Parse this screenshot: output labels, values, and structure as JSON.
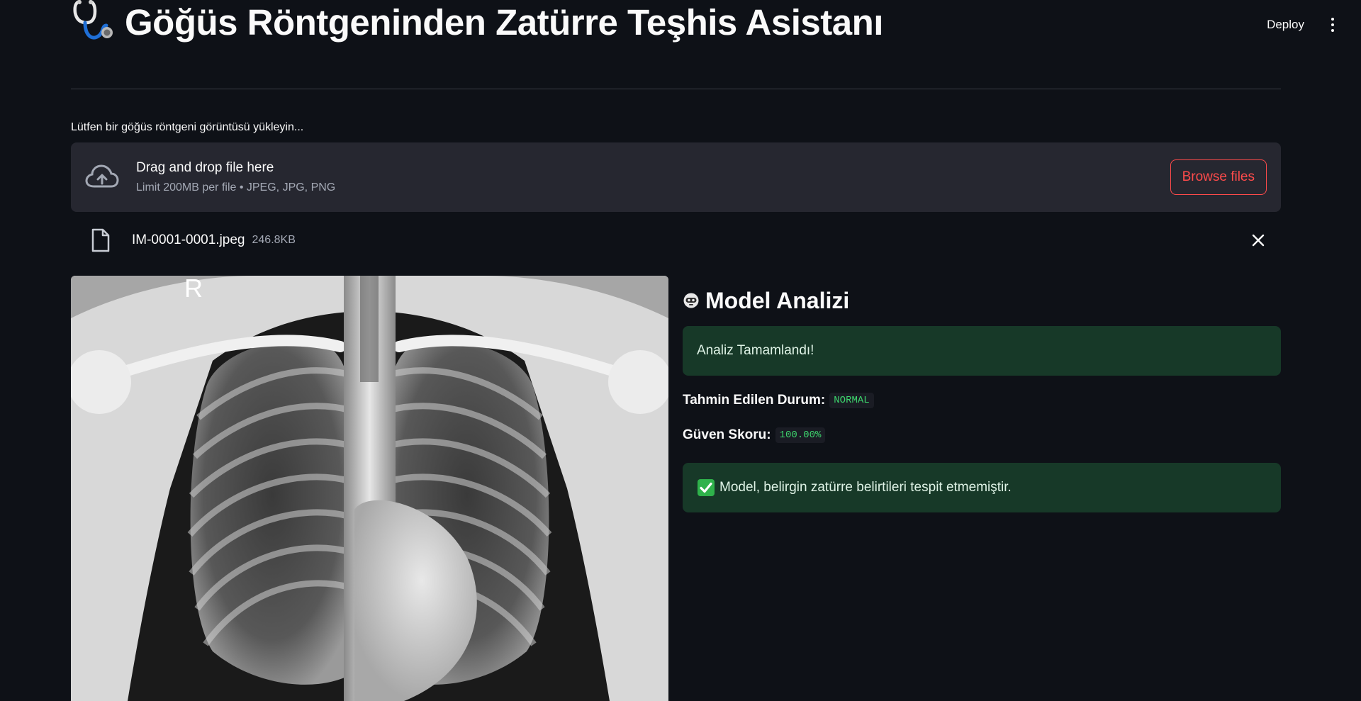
{
  "header": {
    "deploy_label": "Deploy",
    "menu_icon": "vertical-dots-icon"
  },
  "page": {
    "title": "Göğüs Röntgeninden Zatürre Teşhis Asistanı",
    "title_icon": "stethoscope-icon"
  },
  "uploader": {
    "label": "Lütfen bir göğüs röntgeni görüntüsü yükleyin...",
    "drop_text": "Drag and drop file here",
    "limit_text": "Limit 200MB per file • JPEG, JPG, PNG",
    "browse_label": "Browse files",
    "icon": "cloud-upload-icon",
    "accent_color": "#ff4b4b"
  },
  "file": {
    "name": "IM-0001-0001.jpeg",
    "size": "246.8KB",
    "icon": "file-icon",
    "remove_icon": "close-icon"
  },
  "image": {
    "marker": "R"
  },
  "analysis": {
    "heading": "Model Analizi",
    "heading_icon": "robot-icon",
    "status_message": "Analiz Tamamlandı!",
    "prediction_label": "Tahmin Edilen Durum:",
    "prediction_value": "NORMAL",
    "confidence_label": "Güven Skoru:",
    "confidence_value": "100.00%",
    "result_message": "Model, belirgin zatürre belirtileri tespit etmemiştir.",
    "result_icon": "check-mark-icon",
    "success_color": "#173928"
  }
}
